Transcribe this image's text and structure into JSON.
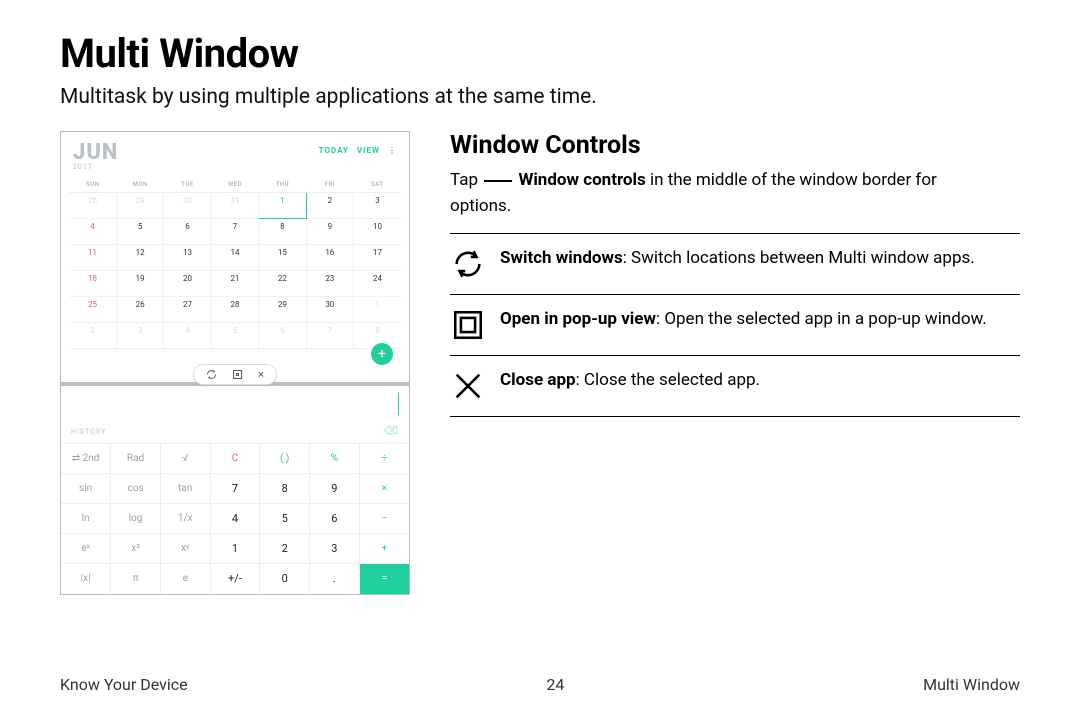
{
  "title": "Multi Window",
  "subtitle": "Multitask by using multiple applications at the same time.",
  "device": {
    "calendar": {
      "month": "JUN",
      "year": "2017",
      "today_label": "TODAY",
      "view_label": "VIEW",
      "more_glyph": "⋮",
      "day_headers": [
        "SUN",
        "MON",
        "TUE",
        "WED",
        "THU",
        "FRI",
        "SAT"
      ],
      "weeks": [
        [
          {
            "n": "28",
            "cls": "dim"
          },
          {
            "n": "29",
            "cls": "dim"
          },
          {
            "n": "30",
            "cls": "dim"
          },
          {
            "n": "31",
            "cls": "dim"
          },
          {
            "n": "1",
            "cls": "today"
          },
          {
            "n": "2",
            "cls": ""
          },
          {
            "n": "3",
            "cls": ""
          }
        ],
        [
          {
            "n": "4",
            "cls": "sun"
          },
          {
            "n": "5",
            "cls": ""
          },
          {
            "n": "6",
            "cls": ""
          },
          {
            "n": "7",
            "cls": ""
          },
          {
            "n": "8",
            "cls": ""
          },
          {
            "n": "9",
            "cls": ""
          },
          {
            "n": "10",
            "cls": ""
          }
        ],
        [
          {
            "n": "11",
            "cls": "sun"
          },
          {
            "n": "12",
            "cls": ""
          },
          {
            "n": "13",
            "cls": ""
          },
          {
            "n": "14",
            "cls": ""
          },
          {
            "n": "15",
            "cls": ""
          },
          {
            "n": "16",
            "cls": ""
          },
          {
            "n": "17",
            "cls": ""
          }
        ],
        [
          {
            "n": "18",
            "cls": "sun"
          },
          {
            "n": "19",
            "cls": ""
          },
          {
            "n": "20",
            "cls": ""
          },
          {
            "n": "21",
            "cls": ""
          },
          {
            "n": "22",
            "cls": ""
          },
          {
            "n": "23",
            "cls": ""
          },
          {
            "n": "24",
            "cls": ""
          }
        ],
        [
          {
            "n": "25",
            "cls": "sun"
          },
          {
            "n": "26",
            "cls": ""
          },
          {
            "n": "27",
            "cls": ""
          },
          {
            "n": "28",
            "cls": ""
          },
          {
            "n": "29",
            "cls": ""
          },
          {
            "n": "30",
            "cls": ""
          },
          {
            "n": "1",
            "cls": "dim"
          }
        ],
        [
          {
            "n": "2",
            "cls": "dim"
          },
          {
            "n": "3",
            "cls": "dim"
          },
          {
            "n": "4",
            "cls": "dim"
          },
          {
            "n": "5",
            "cls": "dim"
          },
          {
            "n": "6",
            "cls": "dim"
          },
          {
            "n": "7",
            "cls": "dim"
          },
          {
            "n": "8",
            "cls": "dim"
          }
        ]
      ],
      "fab_glyph": "+"
    },
    "pill": {
      "x_glyph": "×"
    },
    "calculator": {
      "history_label": "HISTORY",
      "del_glyph": "⌫",
      "rows": [
        [
          {
            "t": "⇄ 2nd",
            "cls": ""
          },
          {
            "t": "Rad",
            "cls": ""
          },
          {
            "t": "√",
            "cls": ""
          },
          {
            "t": "C",
            "cls": "red"
          },
          {
            "t": "( )",
            "cls": "op"
          },
          {
            "t": "%",
            "cls": "op"
          },
          {
            "t": "÷",
            "cls": "op"
          }
        ],
        [
          {
            "t": "sin",
            "cls": ""
          },
          {
            "t": "cos",
            "cls": ""
          },
          {
            "t": "tan",
            "cls": ""
          },
          {
            "t": "7",
            "cls": "num"
          },
          {
            "t": "8",
            "cls": "num"
          },
          {
            "t": "9",
            "cls": "num"
          },
          {
            "t": "×",
            "cls": "op"
          }
        ],
        [
          {
            "t": "ln",
            "cls": ""
          },
          {
            "t": "log",
            "cls": ""
          },
          {
            "t": "1/x",
            "cls": ""
          },
          {
            "t": "4",
            "cls": "num"
          },
          {
            "t": "5",
            "cls": "num"
          },
          {
            "t": "6",
            "cls": "num"
          },
          {
            "t": "−",
            "cls": "op"
          }
        ],
        [
          {
            "t": "eˣ",
            "cls": ""
          },
          {
            "t": "x²",
            "cls": ""
          },
          {
            "t": "xʸ",
            "cls": ""
          },
          {
            "t": "1",
            "cls": "num"
          },
          {
            "t": "2",
            "cls": "num"
          },
          {
            "t": "3",
            "cls": "num"
          },
          {
            "t": "+",
            "cls": "op"
          }
        ],
        [
          {
            "t": "|x|",
            "cls": ""
          },
          {
            "t": "π",
            "cls": ""
          },
          {
            "t": "e",
            "cls": ""
          },
          {
            "t": "+/-",
            "cls": "num"
          },
          {
            "t": "0",
            "cls": "num"
          },
          {
            "t": ".",
            "cls": "num"
          },
          {
            "t": "=",
            "cls": "eq"
          }
        ]
      ]
    }
  },
  "info": {
    "heading": "Window Controls",
    "tap_prefix": "Tap",
    "tap_bold": "Window controls",
    "tap_suffix1": " in the middle of the window border for",
    "tap_suffix2": "options.",
    "features": [
      {
        "icon": "switch",
        "bold": "Switch windows",
        "text": ": Switch locations between Multi window apps."
      },
      {
        "icon": "popup",
        "bold": "Open in pop-up view",
        "text": ": Open the selected app in a pop-up window."
      },
      {
        "icon": "close",
        "bold": "Close app",
        "text": ": Close the selected app."
      }
    ]
  },
  "footer": {
    "left": "Know Your Device",
    "center": "24",
    "right": "Multi Window"
  }
}
